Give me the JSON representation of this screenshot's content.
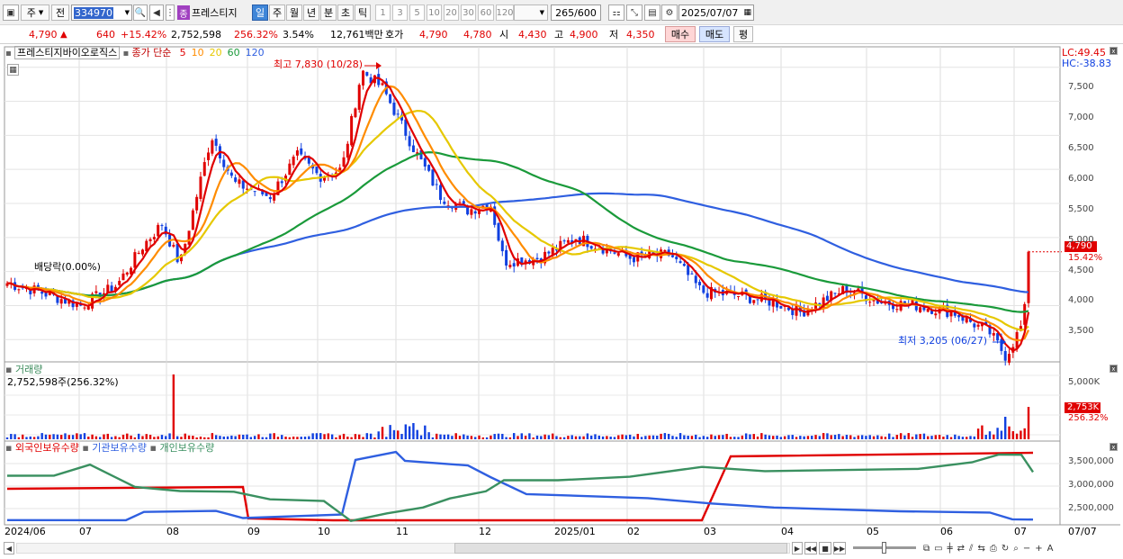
{
  "toolbar": {
    "type_sel": "주",
    "prefix": "전",
    "code": "334970",
    "name": "프레스티지",
    "periods": [
      "일",
      "주",
      "월",
      "년",
      "분",
      "초",
      "틱"
    ],
    "active_period": "일",
    "minutes": [
      "1",
      "3",
      "5",
      "10",
      "20",
      "30",
      "60",
      "120"
    ],
    "count": "265",
    "count_total": "/600",
    "date": "2025/07/07",
    "bullet": "종"
  },
  "quote": {
    "price": "4,790",
    "arrow": "▲",
    "change": "640",
    "change_pct": "+15.42%",
    "volume": "2,752,598",
    "volume_pct": "256.32%",
    "turnover": "3.54%",
    "amount": "12,761백만",
    "hoga_label": "호가",
    "ask": "4,790",
    "bid": "4,780",
    "open_label": "시",
    "open": "4,430",
    "high_label": "고",
    "high": "4,900",
    "low_label": "저",
    "low": "4,350",
    "buy": "매수",
    "sell": "매도",
    "avg": "평"
  },
  "price_panel": {
    "stock_name": "프레스티지바이오로직스",
    "ma_label": "종가 단순",
    "ma_periods": [
      {
        "label": "5",
        "color": "#e00000"
      },
      {
        "label": "10",
        "color": "#ff8c00"
      },
      {
        "label": "20",
        "color": "#e6c800"
      },
      {
        "label": "60",
        "color": "#1a9a3a"
      },
      {
        "label": "120",
        "color": "#2f5fe0"
      }
    ],
    "lc": "LC:49.45",
    "hc": "HC:-38.83",
    "max_note": "최고 7,830 (10/28)",
    "min_note": "최저 3,205 (06/27)",
    "dividend": "배당락(0.00%)",
    "last_price": "4,790",
    "last_pct": "15.42%",
    "y_labels": [
      "7,500",
      "7,000",
      "6,500",
      "6,000",
      "5,500",
      "5,000",
      "4,500",
      "4,000",
      "3,500"
    ]
  },
  "volume_panel": {
    "title": "거래량",
    "value": "2,752,598주(256.32%)",
    "y_labels": [
      "5,000K"
    ],
    "last": "2,753K",
    "last_pct": "256.32%"
  },
  "holding_panel": {
    "foreign": "외국인보유수량",
    "inst": "기관보유수량",
    "indiv": "개인보유수량",
    "y_labels": [
      "3,500,000",
      "3,000,000",
      "2,500,000"
    ]
  },
  "x_axis": {
    "labels": [
      "2024/06",
      "07",
      "08",
      "09",
      "10",
      "11",
      "12",
      "2025/01",
      "02",
      "03",
      "04",
      "05",
      "06",
      "07"
    ],
    "right": "07/07"
  },
  "colors": {
    "up": "#e00000",
    "down": "#1040e0",
    "ma5": "#e00000",
    "ma10": "#ff8c00",
    "ma20": "#e6c800",
    "ma60": "#1a9a3a",
    "ma120": "#2f5fe0",
    "foreign": "#e00000",
    "inst": "#2f5fe0",
    "indiv": "#3a9060"
  },
  "chart_data": {
    "type": "line",
    "title": "프레스티지바이오로직스",
    "x": [
      "2024/06",
      "07",
      "08",
      "09",
      "10",
      "11",
      "12",
      "2025/01",
      "02",
      "03",
      "04",
      "05",
      "06",
      "07"
    ],
    "series": [
      {
        "name": "5",
        "values": [
          4300,
          4100,
          5800,
          5600,
          6000,
          7100,
          5300,
          4900,
          4700,
          4200,
          3900,
          4200,
          3900,
          3600,
          4000
        ]
      },
      {
        "name": "60",
        "values": [
          4250,
          4150,
          4400,
          5200,
          5700,
          6200,
          5700,
          5100,
          4800,
          4350,
          4150,
          4100,
          3950,
          3850,
          3900
        ]
      },
      {
        "name": "120",
        "values": [
          4350,
          4250,
          4300,
          4500,
          4900,
          5400,
          5650,
          5750,
          5550,
          5300,
          4900,
          4600,
          4350,
          4250,
          4200
        ]
      }
    ],
    "ylim": [
      3200,
      7800
    ],
    "max": {
      "label": "최고",
      "value": 7830,
      "date": "10/28"
    },
    "min": {
      "label": "최저",
      "value": 3205,
      "date": "06/27"
    }
  }
}
